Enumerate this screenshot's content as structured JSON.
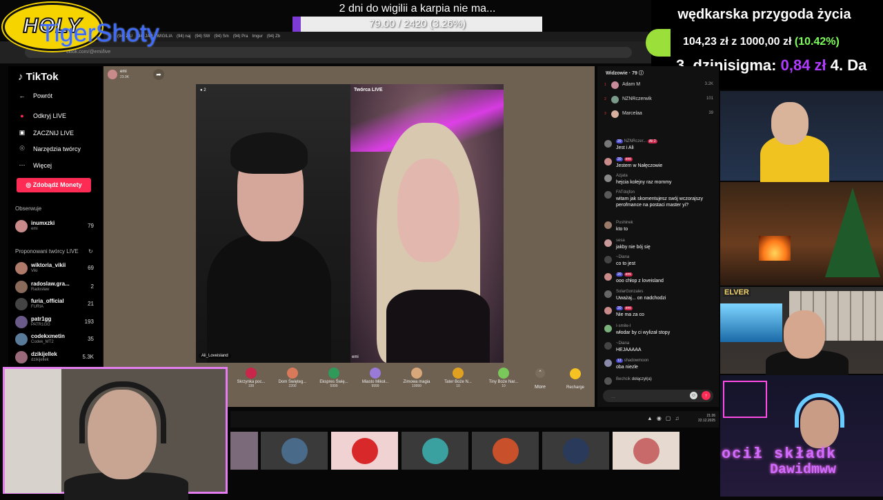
{
  "overlay": {
    "logo_text": "HOLY",
    "channel_name": "TigerShoty",
    "goal_title": "2 dni do wigilii a karpia nie ma...",
    "goal_progress_text": "79.00 / 2420 (3.26%)",
    "goal_progress_pct": 3.26,
    "right_title": "wędkarska przygoda życia",
    "money_goal_amount": "104,23 zł",
    "money_goal_sep": "z",
    "money_goal_total": "1000,00 zł",
    "money_goal_pct": "(10.42%)",
    "money_goal_fraction": 0.1042,
    "ranking_prefix": "3. dzinisigma:",
    "ranking_amount": "0,84 zł",
    "ranking_next": "4. Da",
    "accent_purple": "#7d3bd6",
    "accent_pink": "#fe2c55"
  },
  "browser": {
    "tabs": [
      "(94) Z U",
      "(94) JAP",
      "WIGILIA",
      "(94) naj",
      "(94) SW",
      "(94) Sm",
      "(94) Pra",
      "Imgur",
      "(94) Zb"
    ],
    "url": "tiktok.com/@emi/live"
  },
  "sidebar": {
    "brand": "TikTok",
    "back_label": "Powrót",
    "nav": [
      {
        "icon": "live-icon",
        "label": "Odkryj LIVE"
      },
      {
        "icon": "camera-icon",
        "label": "ZACZNIJ LIVE"
      },
      {
        "icon": "tools-icon",
        "label": "Narzędzia twórcy"
      },
      {
        "icon": "more-icon",
        "label": "Więcej"
      }
    ],
    "coins_button": "Zdobądź Monety",
    "following_title": "Obserwuje",
    "following": [
      {
        "name": "inumxzki",
        "sub": "emi",
        "count": "79"
      }
    ],
    "suggested_title": "Proponowani twórcy LIVE",
    "suggested": [
      {
        "name": "wiktoria_vikii",
        "sub": "Viki",
        "count": "69"
      },
      {
        "name": "radoslaw.gra...",
        "sub": "Radosław",
        "count": "2"
      },
      {
        "name": "furia_official",
        "sub": "FURIA",
        "count": "21"
      },
      {
        "name": "patr1gg",
        "sub": "PATR1GG",
        "count": "193"
      },
      {
        "name": "codekxmetin",
        "sub": "Codek_MT2",
        "count": "35"
      },
      {
        "name": "dzikijellek",
        "sub": "dzikijellek",
        "count": "5.3K"
      }
    ]
  },
  "stream": {
    "host_name": "emi",
    "host_likes": "23.9K",
    "left_tag": "2",
    "left_name": "Ali_Loveisland",
    "right_tag": "Twórca LIVE",
    "right_name": "emi",
    "gifts": [
      {
        "name": "Skrzynka poc...",
        "price": "199"
      },
      {
        "name": "Dom Święteg...",
        "price": "2200"
      },
      {
        "name": "Ekspres Świę...",
        "price": "5999"
      },
      {
        "name": "Miasto Mikoł...",
        "price": "9999"
      },
      {
        "name": "Zimowa magia",
        "price": "19999"
      },
      {
        "name": "Tater Boże N...",
        "price": "10"
      },
      {
        "name": "Tiny Boże Nar...",
        "price": "10"
      }
    ],
    "more_label": "More",
    "recharge_label": "Recharge"
  },
  "chat": {
    "viewers_title": "Widzowie",
    "viewers_count": "79",
    "top_viewers": [
      {
        "rank": "1",
        "name": "Adam M",
        "score": "3.2K"
      },
      {
        "rank": "2",
        "name": "NZNRczerwik",
        "score": "101"
      },
      {
        "rank": "3",
        "name": "Marcelaa",
        "score": "39"
      }
    ],
    "messages": [
      {
        "badge": "20",
        "user": "NZNRczer...",
        "text": "Jest i Ali"
      },
      {
        "badge": "20",
        "user": "emi",
        "text": "Jestem w Nałęczowie"
      },
      {
        "badge": "",
        "user": "Azjata",
        "text": "hejcia kolejny raz mommy"
      },
      {
        "badge": "",
        "user": "FATdojfon",
        "text": "witam jak skomentujesz swój wczorajszy perofmance na postaci master yi?"
      },
      {
        "badge": "",
        "user": "Pushinek",
        "text": "kto to"
      },
      {
        "badge": "",
        "user": "sesa",
        "text": "jakby nie bój się"
      },
      {
        "badge": "",
        "user": "~Diana",
        "text": "co to jest"
      },
      {
        "badge": "20",
        "user": "emi",
        "text": "ooo chłop z loveisland"
      },
      {
        "badge": "",
        "user": "SolarGonzales",
        "text": "Uważaj... on nadchodzi"
      },
      {
        "badge": "20",
        "user": "emi",
        "text": "Nie ma za co"
      },
      {
        "badge": "",
        "user": "I-smile-I",
        "text": "włodar by ci wylizał stopy"
      },
      {
        "badge": "",
        "user": "~Diana",
        "text": "HEJAAAAA"
      },
      {
        "badge": "12",
        "user": "shadowmoon",
        "text": "oba niezle"
      },
      {
        "badge": "",
        "user": "Bechcik",
        "text": "dołączył(a)"
      }
    ],
    "input_placeholder": "..."
  },
  "taskbar": {
    "time": "21:26",
    "date": "22.12.2025"
  },
  "cams": {
    "r3_tag": "ELVER",
    "r4_line1": "ocił składk",
    "r4_line2": "Dawidmww"
  }
}
